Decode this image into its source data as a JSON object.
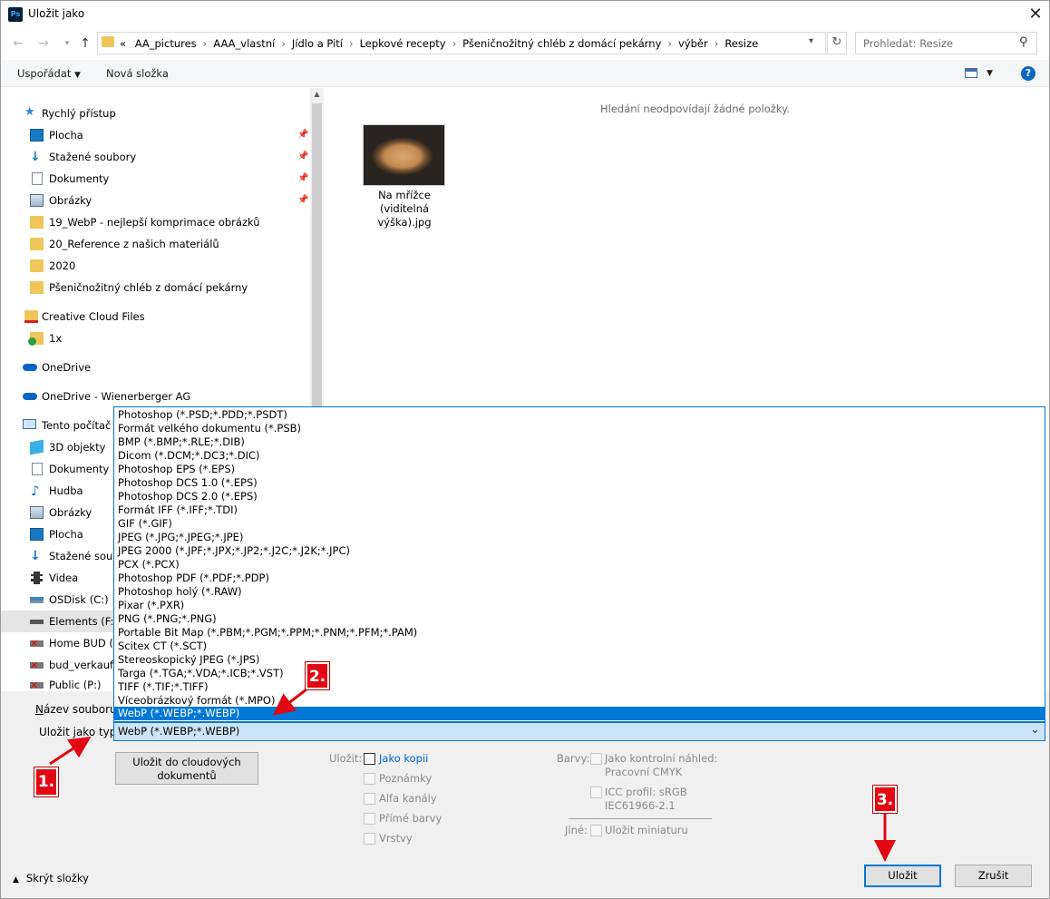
{
  "window": {
    "title": "Uložit jako",
    "app_icon": "Ps"
  },
  "address": {
    "prefix": "«",
    "crumbs": [
      "AA_pictures",
      "AAA_vlastní",
      "Jídlo a Pití",
      "Lepkové recepty",
      "Pšeničnožitný chléb z domácí pekárny",
      "výběr",
      "Resize"
    ],
    "search_placeholder": "Prohledat: Resize"
  },
  "toolbar": {
    "organize": "Uspořádat",
    "new_folder": "Nová složka"
  },
  "nav": {
    "quick_access": "Rychlý přístup",
    "quick_items": [
      "Plocha",
      "Stažené soubory",
      "Dokumenty",
      "Obrázky",
      "19_WebP - nejlepší komprimace obrázků",
      "20_Reference z našich materiálů",
      "2020",
      "Pšeničnožitný chléb z domácí pekárny"
    ],
    "creative_cloud": "Creative Cloud Files",
    "cc_sub": "1x",
    "onedrive": "OneDrive",
    "onedrive_work": "OneDrive - Wienerberger AG",
    "this_pc": "Tento počítač",
    "pc_items": [
      "3D objekty",
      "Dokumenty",
      "Hudba",
      "Obrázky",
      "Plocha",
      "Stažené soubo",
      "Videa",
      "OSDisk (C:)",
      "Elements (F:)",
      "Home BUD (H",
      "bud_verkauf (",
      "Public (P:)"
    ]
  },
  "content": {
    "empty_message": "Hledání neodpovídají žádné položky.",
    "file_caption": [
      "Na mřížce",
      "(viditelná",
      "výška).jpg"
    ]
  },
  "file_types": [
    "Photoshop (*.PSD;*.PDD;*.PSDT)",
    "Formát velkého dokumentu (*.PSB)",
    "BMP (*.BMP;*.RLE;*.DIB)",
    "Dicom (*.DCM;*.DC3;*.DIC)",
    "Photoshop EPS (*.EPS)",
    "Photoshop DCS 1.0 (*.EPS)",
    "Photoshop DCS 2.0 (*.EPS)",
    "Formát IFF (*.IFF;*.TDI)",
    "GIF (*.GIF)",
    "JPEG (*.JPG;*.JPEG;*.JPE)",
    "JPEG 2000 (*.JPF;*.JPX;*.JP2;*.J2C;*.J2K;*.JPC)",
    "PCX (*.PCX)",
    "Photoshop PDF (*.PDF;*.PDP)",
    "Photoshop holý (*.RAW)",
    "Pixar (*.PXR)",
    "PNG (*.PNG;*.PNG)",
    "Portable Bit Map (*.PBM;*.PGM;*.PPM;*.PNM;*.PFM;*.PAM)",
    "Scitex CT (*.SCT)",
    "Stereoskopický JPEG  (*.JPS)",
    "Targa (*.TGA;*.VDA;*.ICB;*.VST)",
    "TIFF (*.TIF;*.TIFF)",
    "Víceobrázkový formát (*.MPO)",
    "WebP (*.WEBP;*.WEBP)"
  ],
  "form": {
    "filename_label_u": "N",
    "filename_label_rest": "ázev souboru:",
    "type_label": "Uložit jako typ:",
    "type_value": "WebP (*.WEBP;*.WEBP)",
    "cloud_button_line1": "Uložit do cloudových",
    "cloud_button_line2": "dokumentů",
    "save_label": "Uložit:",
    "as_copy": "Jako kopii",
    "notes": "Poznámky",
    "alpha": "Alfa kanály",
    "spot": "Přímé barvy",
    "layers": "Vrstvy",
    "colors_label": "Barvy:",
    "proof": "Jako kontrolní náhled:",
    "proof_sub": "Pracovní CMYK",
    "icc": "ICC profil:  sRGB",
    "icc_sub": "IEC61966-2.1",
    "other_label": "Jiné:",
    "thumbnail": "Uložit miniaturu",
    "hide_folders": "Skrýt složky",
    "save_button": "Uložit",
    "cancel_button": "Zrušit"
  },
  "annotations": {
    "step1": "1.",
    "step2": "2.",
    "step3": "3.",
    "color": "#e30613"
  }
}
